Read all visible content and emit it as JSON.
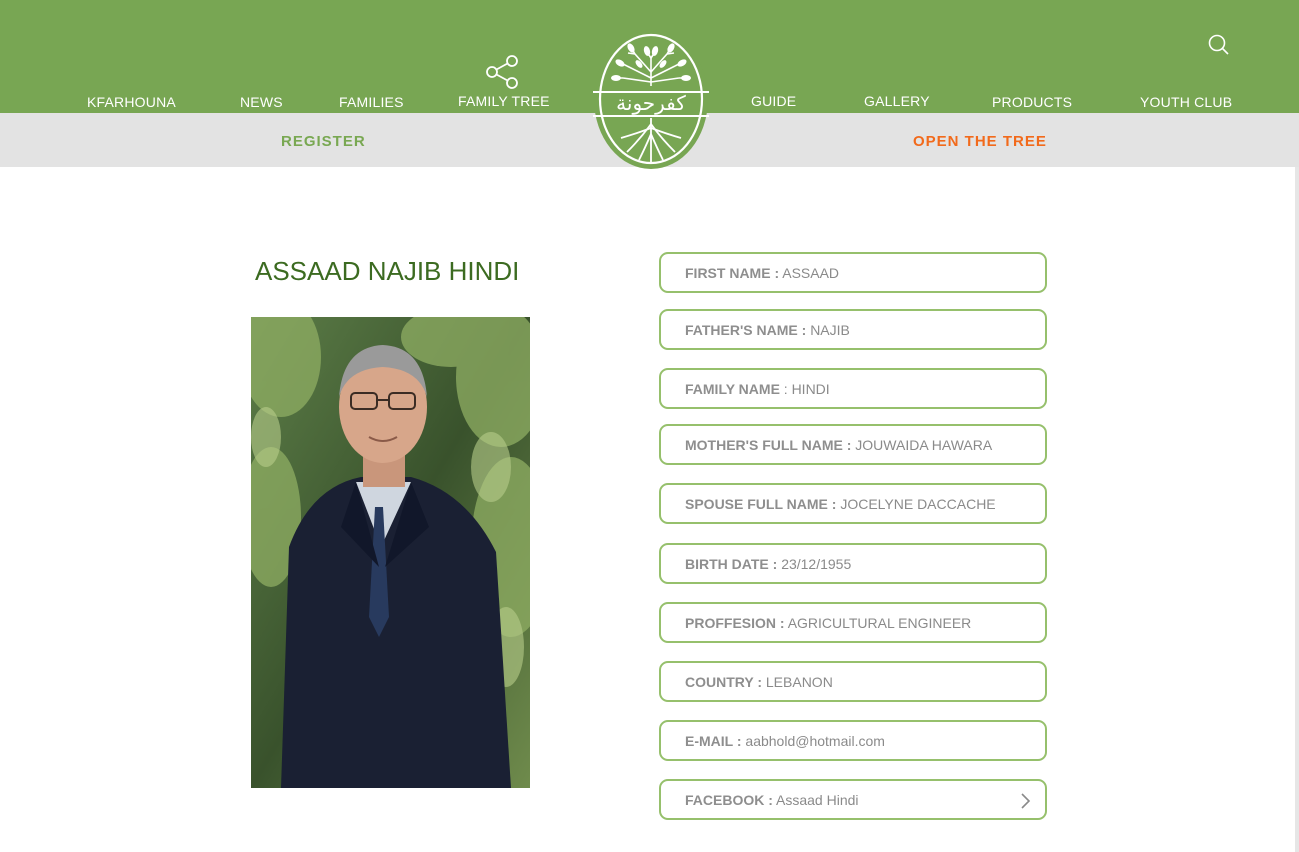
{
  "colors": {
    "header_green": "#78a653",
    "subbar_gray": "#e3e3e3",
    "register_green": "#79a852",
    "open_tree_orange": "#f26a1b",
    "name_green": "#3c6b21",
    "field_border": "#96c06c"
  },
  "nav": {
    "items": [
      "KFARHOUNA",
      "NEWS",
      "FAMILIES",
      "FAMILY TREE",
      "GUIDE",
      "GALLERY",
      "PRODUCTS",
      "YOUTH CLUB"
    ],
    "share_icon": "share-icon",
    "search_icon": "search-icon"
  },
  "logo": {
    "arabic_text": "كفرحونة"
  },
  "subnav": {
    "register": "REGISTER",
    "open_tree": "OPEN THE TREE"
  },
  "profile": {
    "full_name": "ASSAAD NAJIB HINDI",
    "fields": [
      {
        "label": "FIRST NAME :",
        "value": "ASSAAD"
      },
      {
        "label": "FATHER'S NAME :",
        "value": "NAJIB"
      },
      {
        "label": "FAMILY NAME",
        "value": ": HINDI"
      },
      {
        "label": "MOTHER'S FULL NAME :",
        "value": "JOUWAIDA HAWARA"
      },
      {
        "label": "SPOUSE FULL NAME :",
        "value": "JOCELYNE DACCACHE"
      },
      {
        "label": "BIRTH DATE :",
        "value": "23/12/1955"
      },
      {
        "label": "PROFFESION :",
        "value": "AGRICULTURAL ENGINEER"
      },
      {
        "label": "COUNTRY :",
        "value": "LEBANON"
      },
      {
        "label": "E-MAIL :",
        "value": "aabhold@hotmail.com"
      },
      {
        "label": "FACEBOOK :",
        "value": "Assaad Hindi"
      }
    ]
  }
}
